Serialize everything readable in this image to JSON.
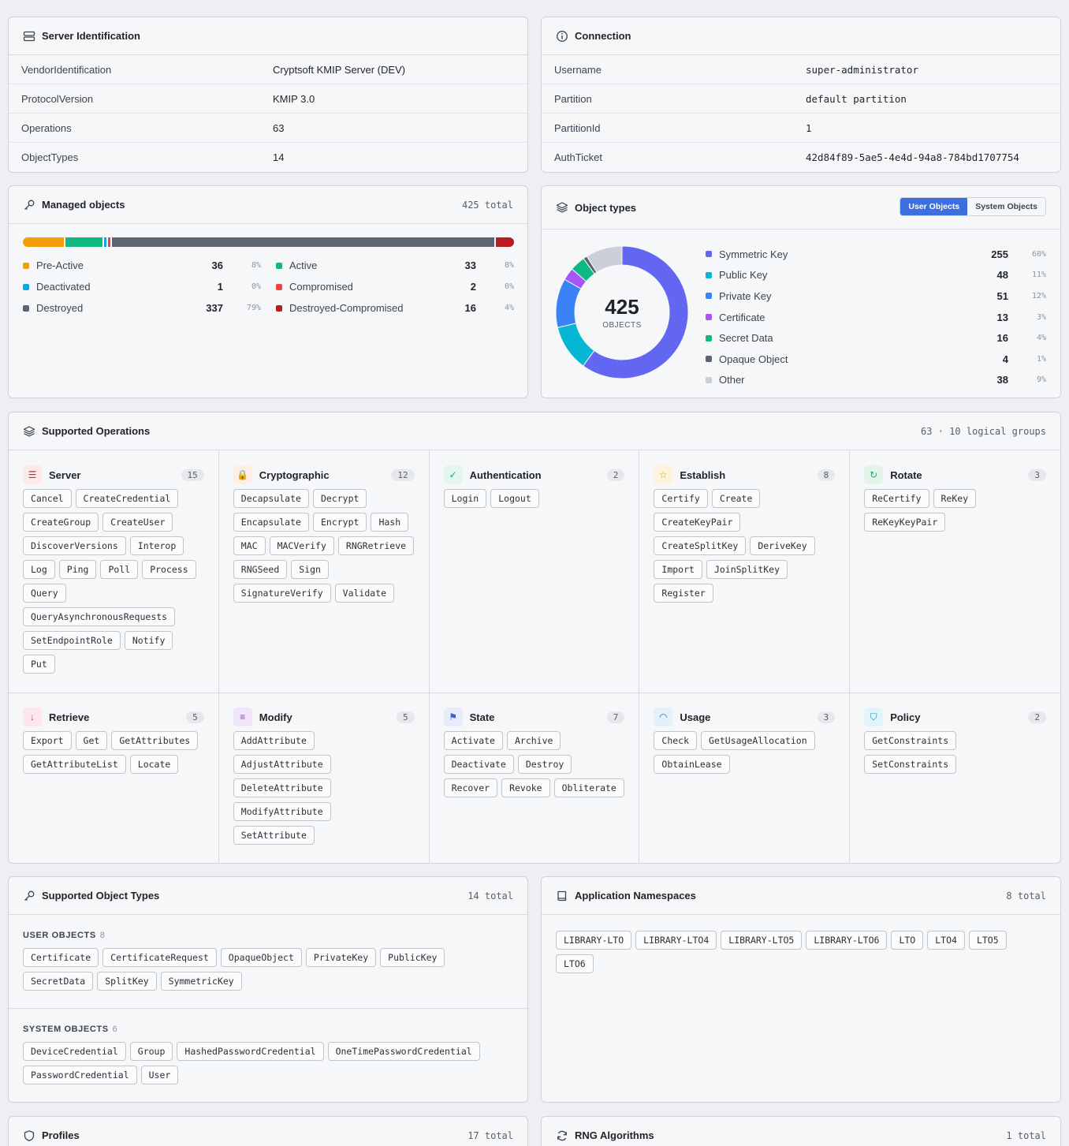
{
  "server_identification": {
    "title": "Server Identification",
    "rows": [
      {
        "key": "VendorIdentification",
        "value": "Cryptsoft KMIP Server (DEV)"
      },
      {
        "key": "ProtocolVersion",
        "value": "KMIP 3.0"
      },
      {
        "key": "Operations",
        "value": "63"
      },
      {
        "key": "ObjectTypes",
        "value": "14"
      }
    ]
  },
  "connection": {
    "title": "Connection",
    "rows": [
      {
        "key": "Username",
        "value": "super-administrator"
      },
      {
        "key": "Partition",
        "value": "default partition"
      },
      {
        "key": "PartitionId",
        "value": "1"
      },
      {
        "key": "AuthTicket",
        "value": "42d84f89-5ae5-4e4d-94a8-784bd1707754"
      }
    ]
  },
  "managed_objects": {
    "title": "Managed objects",
    "total": "425 total",
    "states": [
      {
        "name": "Pre-Active",
        "count": 36,
        "pct": "8%",
        "color": "#f59e0b"
      },
      {
        "name": "Active",
        "count": 33,
        "pct": "8%",
        "color": "#10b981"
      },
      {
        "name": "Deactivated",
        "count": 1,
        "pct": "0%",
        "color": "#0ea5e9"
      },
      {
        "name": "Compromised",
        "count": 2,
        "pct": "0%",
        "color": "#ef4444"
      },
      {
        "name": "Destroyed",
        "count": 337,
        "pct": "79%",
        "color": "#5b6470"
      },
      {
        "name": "Destroyed-Compromised",
        "count": 16,
        "pct": "4%",
        "color": "#b91c1c"
      }
    ]
  },
  "object_types": {
    "title": "Object types",
    "toggle": [
      "User Objects",
      "System Objects"
    ],
    "center_value": "425",
    "center_label": "OBJECTS",
    "items": [
      {
        "name": "Symmetric Key",
        "count": 255,
        "pct": "60%",
        "color": "#6366f1"
      },
      {
        "name": "Public Key",
        "count": 48,
        "pct": "11%",
        "color": "#06b6d4"
      },
      {
        "name": "Private Key",
        "count": 51,
        "pct": "12%",
        "color": "#3b82f6"
      },
      {
        "name": "Certificate",
        "count": 13,
        "pct": "3%",
        "color": "#a855f7"
      },
      {
        "name": "Secret Data",
        "count": 16,
        "pct": "4%",
        "color": "#10b981"
      },
      {
        "name": "Opaque Object",
        "count": 4,
        "pct": "1%",
        "color": "#5b6470"
      },
      {
        "name": "Other",
        "count": 38,
        "pct": "9%",
        "color": "#cbd0d8"
      }
    ]
  },
  "supported_operations": {
    "title": "Supported Operations",
    "summary": "63 · 10 logical groups",
    "groups": [
      {
        "name": "Server",
        "count": "15",
        "icon": "server-icon",
        "tint": "#fde8ea",
        "fg": "#c0392b",
        "glyph": "☰",
        "ops": [
          "Cancel",
          "CreateCredential",
          "CreateGroup",
          "CreateUser",
          "DiscoverVersions",
          "Interop",
          "Log",
          "Ping",
          "Poll",
          "Process",
          "Query",
          "QueryAsynchronousRequests",
          "SetEndpointRole",
          "Notify",
          "Put"
        ]
      },
      {
        "name": "Cryptographic",
        "count": "12",
        "icon": "lock-icon",
        "tint": "#fdeee4",
        "fg": "#e67e22",
        "glyph": "🔒",
        "ops": [
          "Decapsulate",
          "Decrypt",
          "Encapsulate",
          "Encrypt",
          "Hash",
          "MAC",
          "MACVerify",
          "RNGRetrieve",
          "RNGSeed",
          "Sign",
          "SignatureVerify",
          "Validate"
        ]
      },
      {
        "name": "Authentication",
        "count": "2",
        "icon": "user-check-icon",
        "tint": "#e3f5ef",
        "fg": "#16a085",
        "glyph": "✓",
        "ops": [
          "Login",
          "Logout"
        ]
      },
      {
        "name": "Establish",
        "count": "8",
        "icon": "star-icon",
        "tint": "#fdf3dc",
        "fg": "#d4a015",
        "glyph": "☆",
        "ops": [
          "Certify",
          "Create",
          "CreateKeyPair",
          "CreateSplitKey",
          "DeriveKey",
          "Import",
          "JoinSplitKey",
          "Register"
        ]
      },
      {
        "name": "Rotate",
        "count": "3",
        "icon": "rotate-icon",
        "tint": "#e3f5ea",
        "fg": "#27ae60",
        "glyph": "↻",
        "ops": [
          "ReCertify",
          "ReKey",
          "ReKeyKeyPair"
        ]
      },
      {
        "name": "Retrieve",
        "count": "5",
        "icon": "download-icon",
        "tint": "#fde6ef",
        "fg": "#d6336c",
        "glyph": "↓",
        "ops": [
          "Export",
          "Get",
          "GetAttributes",
          "GetAttributeList",
          "Locate"
        ]
      },
      {
        "name": "Modify",
        "count": "5",
        "icon": "edit-icon",
        "tint": "#efe6fb",
        "fg": "#8e44ad",
        "glyph": "≡",
        "ops": [
          "AddAttribute",
          "AdjustAttribute",
          "DeleteAttribute",
          "ModifyAttribute",
          "SetAttribute"
        ]
      },
      {
        "name": "State",
        "count": "7",
        "icon": "flag-icon",
        "tint": "#e6ecfb",
        "fg": "#3b5bdb",
        "glyph": "⚑",
        "ops": [
          "Activate",
          "Archive",
          "Deactivate",
          "Destroy",
          "Recover",
          "Revoke",
          "Obliterate"
        ]
      },
      {
        "name": "Usage",
        "count": "3",
        "icon": "gauge-icon",
        "tint": "#e3f1f8",
        "fg": "#1c7ed6",
        "glyph": "◠",
        "ops": [
          "Check",
          "GetUsageAllocation",
          "ObtainLease"
        ]
      },
      {
        "name": "Policy",
        "count": "2",
        "icon": "shield-icon",
        "tint": "#e3f3fb",
        "fg": "#1098ad",
        "glyph": "⛉",
        "ops": [
          "GetConstraints",
          "SetConstraints"
        ]
      }
    ]
  },
  "supported_object_types": {
    "title": "Supported Object Types",
    "total": "14 total",
    "user_label": "USER OBJECTS",
    "user_count": "8",
    "user_objects": [
      "Certificate",
      "CertificateRequest",
      "OpaqueObject",
      "PrivateKey",
      "PublicKey",
      "SecretData",
      "SplitKey",
      "SymmetricKey"
    ],
    "system_label": "SYSTEM OBJECTS",
    "system_count": "6",
    "system_objects": [
      "DeviceCredential",
      "Group",
      "HashedPasswordCredential",
      "OneTimePasswordCredential",
      "PasswordCredential",
      "User"
    ]
  },
  "application_namespaces": {
    "title": "Application Namespaces",
    "total": "8 total",
    "items": [
      "LIBRARY-LTO",
      "LIBRARY-LTO4",
      "LIBRARY-LTO5",
      "LIBRARY-LTO6",
      "LTO",
      "LTO4",
      "LTO5",
      "LTO6"
    ]
  },
  "profiles": {
    "title": "Profiles",
    "total": "17 total"
  },
  "rng_algorithms": {
    "title": "RNG Algorithms",
    "total": "1 total"
  }
}
